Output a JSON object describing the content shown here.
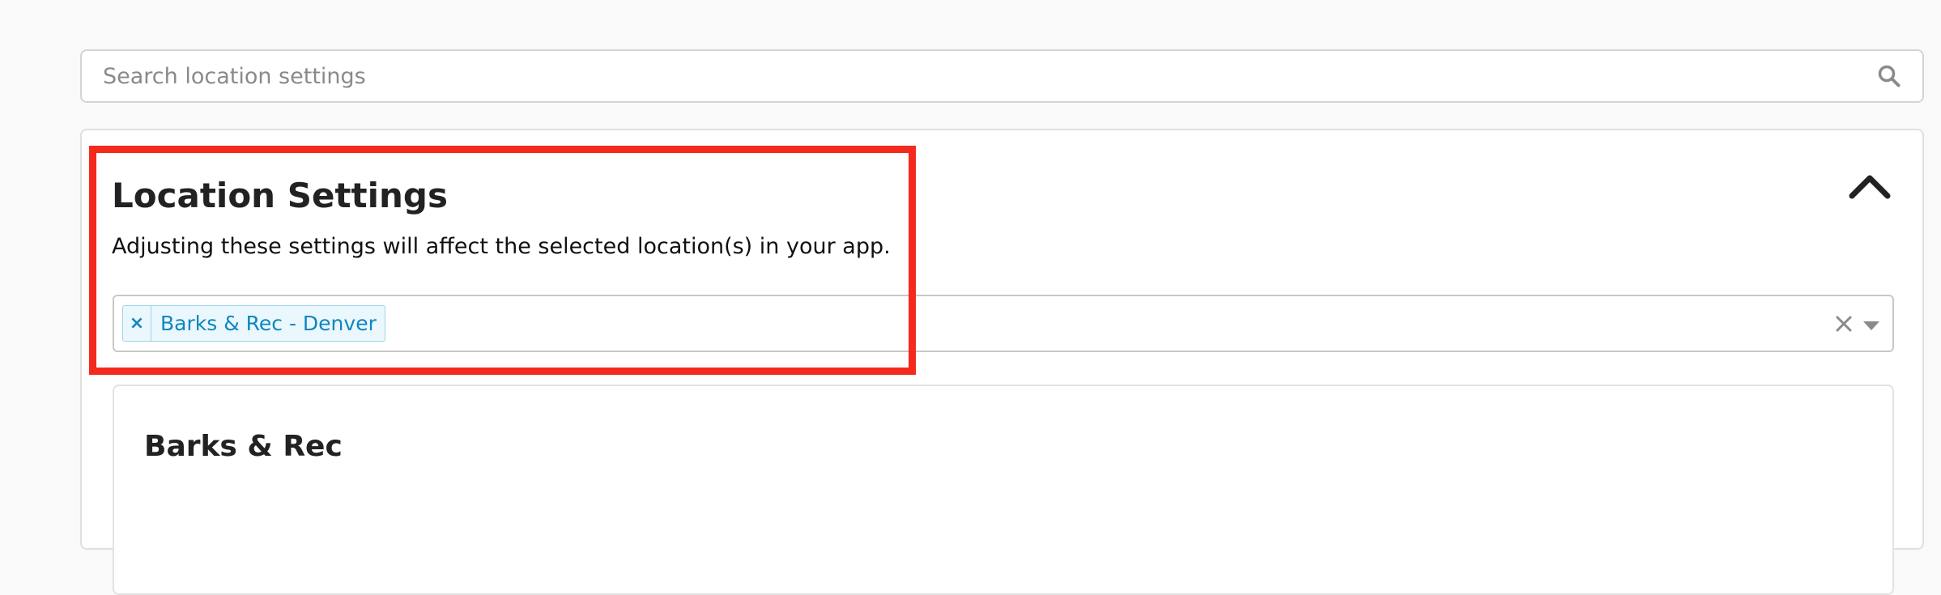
{
  "search": {
    "placeholder": "Search location settings",
    "value": "",
    "icon": "search-icon"
  },
  "panel": {
    "title": "Location Settings",
    "description": "Adjusting these settings will affect the selected location(s) in your app.",
    "collapse_icon": "chevron-up-icon"
  },
  "location_select": {
    "selected": [
      {
        "label": "Barks & Rec - Denver",
        "remove_symbol": "×"
      }
    ],
    "clear_icon": "close-icon",
    "dropdown_icon": "caret-down-icon"
  },
  "subcard": {
    "title": "Barks & Rec"
  },
  "colors": {
    "page_background": "#f9f9f9",
    "tag_text": "#0e86c0",
    "tag_background": "#eaf7fc",
    "tag_border": "#9fd3ea",
    "highlight_border": "#f42a1d"
  }
}
